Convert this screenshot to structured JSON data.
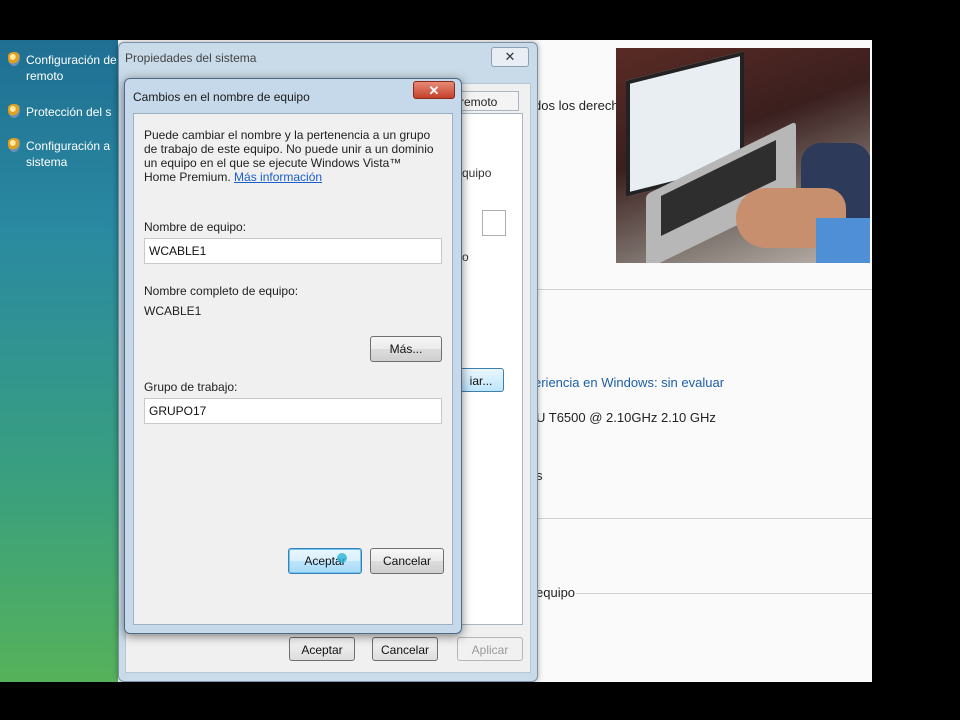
{
  "sidebar": {
    "items": [
      {
        "label": "Configuración de remoto"
      },
      {
        "label": "Protección del s"
      },
      {
        "label": "Configuración a sistema"
      }
    ]
  },
  "background": {
    "rights_text": "dos los derechos",
    "experience_link": "eriencia en Windows: sin evaluar",
    "cpu_text": "U     T6500  @ 2.10GHz   2.10 GHz",
    "s_frag": "s",
    "equipo_frag": "equipo"
  },
  "system_properties": {
    "title": "Propiedades del sistema",
    "close_glyph": "✕",
    "tab_remote": "remoto",
    "frag_equipo": "quipo",
    "frag_o": "o",
    "change_button_frag": "iar...",
    "ok": "Aceptar",
    "cancel": "Cancelar",
    "apply": "Aplicar"
  },
  "name_change_dialog": {
    "title": "Cambios en el nombre de equipo",
    "close_glyph": "✕",
    "description": "Puede cambiar el nombre y la pertenencia a un grupo de trabajo de este equipo. No puede unir a un dominio un equipo en el que se ejecute Windows Vista™ Home Premium.",
    "more_info_link": "Más información",
    "computer_name_label": "Nombre de equipo:",
    "computer_name_value": "WCABLE1",
    "full_name_label": "Nombre completo de equipo:",
    "full_name_value": "WCABLE1",
    "more_button": "Más...",
    "workgroup_label": "Grupo de trabajo:",
    "workgroup_value": "GRUPO17",
    "ok": "Aceptar",
    "cancel": "Cancelar"
  }
}
